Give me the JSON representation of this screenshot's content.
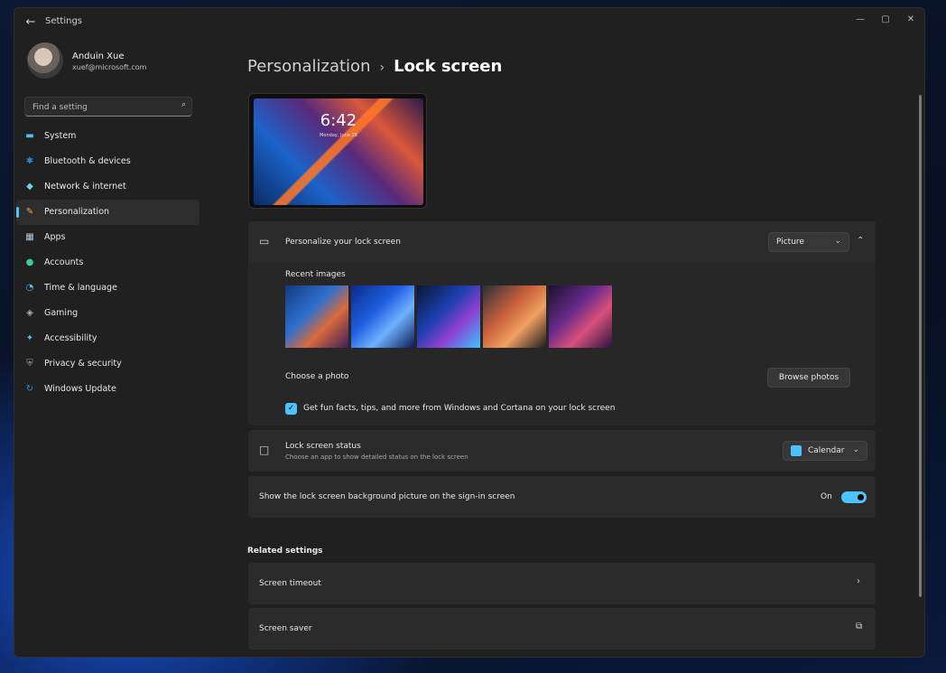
{
  "window": {
    "app_title": "Settings",
    "back_icon": "←",
    "controls": {
      "minimize": "—",
      "maximize": "▢",
      "close": "✕"
    }
  },
  "user": {
    "name": "Anduin Xue",
    "email": "xuef@microsoft.com"
  },
  "search": {
    "placeholder": "Find a setting",
    "value": "",
    "icon": "⌕"
  },
  "sidebar": {
    "items": [
      {
        "label": "System",
        "icon": "▬",
        "color": "#4cc2ff",
        "active": false
      },
      {
        "label": "Bluetooth & devices",
        "icon": "✱",
        "color": "#2b88d8",
        "active": false
      },
      {
        "label": "Network & internet",
        "icon": "◆",
        "color": "#6ccff6",
        "active": false
      },
      {
        "label": "Personalization",
        "icon": "✎",
        "color": "#f2a65a",
        "active": true
      },
      {
        "label": "Apps",
        "icon": "▦",
        "color": "#b8c9e0",
        "active": false
      },
      {
        "label": "Accounts",
        "icon": "●",
        "color": "#3ccf91",
        "active": false
      },
      {
        "label": "Time & language",
        "icon": "◔",
        "color": "#4cc2ff",
        "active": false
      },
      {
        "label": "Gaming",
        "icon": "◈",
        "color": "#b0b0b0",
        "active": false
      },
      {
        "label": "Accessibility",
        "icon": "✦",
        "color": "#4cc2ff",
        "active": false
      },
      {
        "label": "Privacy & security",
        "icon": "⛨",
        "color": "#a0a0a0",
        "active": false
      },
      {
        "label": "Windows Update",
        "icon": "↻",
        "color": "#2b88d8",
        "active": false
      }
    ]
  },
  "breadcrumb": {
    "parent": "Personalization",
    "separator": "›",
    "current": "Lock screen"
  },
  "preview": {
    "time": "6:42",
    "date": "Monday, June 28"
  },
  "personalize": {
    "icon": "▭",
    "title": "Personalize your lock screen",
    "selected": "Picture",
    "recent_images_label": "Recent images",
    "images": [
      {
        "name": "recent-image-1",
        "colors": [
          "#123a7a",
          "#2e6fd0",
          "#d86a3a",
          "#3b1f5c"
        ]
      },
      {
        "name": "recent-image-2",
        "colors": [
          "#0a2a8a",
          "#1f5fe0",
          "#6fb2ff",
          "#0c1a55"
        ]
      },
      {
        "name": "recent-image-3",
        "colors": [
          "#0c1530",
          "#1b3fb0",
          "#8b3fd0",
          "#3ec4ff"
        ]
      },
      {
        "name": "recent-image-4",
        "colors": [
          "#2a2f3a",
          "#c7603a",
          "#f0a060",
          "#1a1c22"
        ]
      },
      {
        "name": "recent-image-5",
        "colors": [
          "#1a1030",
          "#6a2a8a",
          "#d8507a",
          "#2a1440"
        ]
      }
    ],
    "choose_photo_label": "Choose a photo",
    "browse_button": "Browse photos",
    "checkbox_checked": true,
    "checkbox_label": "Get fun facts, tips, and more from Windows and Cortana on your lock screen"
  },
  "status": {
    "icon": "□",
    "title": "Lock screen status",
    "subtitle": "Choose an app to show detailed status on the lock screen",
    "selected": "Calendar"
  },
  "signin": {
    "label": "Show the lock screen background picture on the sign-in screen",
    "state_label": "On",
    "on": true
  },
  "related": {
    "title": "Related settings",
    "items": [
      {
        "label": "Screen timeout",
        "icon": "›"
      },
      {
        "label": "Screen saver",
        "icon": "⧉"
      }
    ]
  },
  "colors": {
    "accent": "#4cc2ff",
    "window_bg": "#202020",
    "card_bg": "#2b2b2b"
  }
}
